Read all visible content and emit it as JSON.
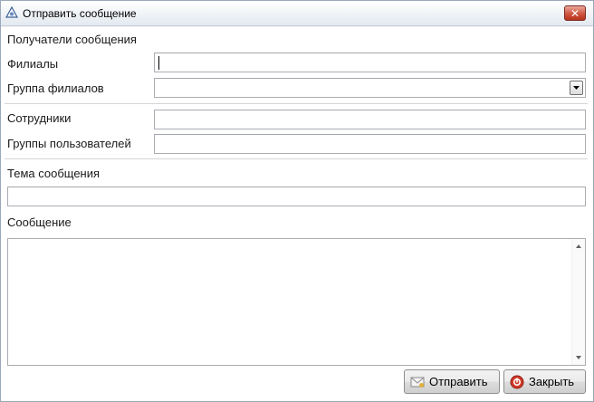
{
  "window": {
    "title": "Отправить сообщение",
    "close_label": "✕",
    "title_icon": "app-logo-icon"
  },
  "recipients": {
    "heading": "Получатели сообщения",
    "branches_label": "Филиалы",
    "branches_value": "",
    "branch_group_label": "Группа филиалов",
    "branch_group_value": "",
    "employees_label": "Сотрудники",
    "employees_value": "",
    "user_groups_label": "Группы пользователей",
    "user_groups_value": ""
  },
  "message": {
    "subject_label": "Тема сообщения",
    "subject_value": "",
    "body_label": "Сообщение",
    "body_value": ""
  },
  "buttons": {
    "send_label": "Отправить",
    "send_icon": "envelope-icon",
    "close_label": "Закрыть",
    "close_icon": "stop-icon"
  },
  "colors": {
    "close_accent": "#d0553f",
    "stop_icon": "#d23a2a"
  }
}
